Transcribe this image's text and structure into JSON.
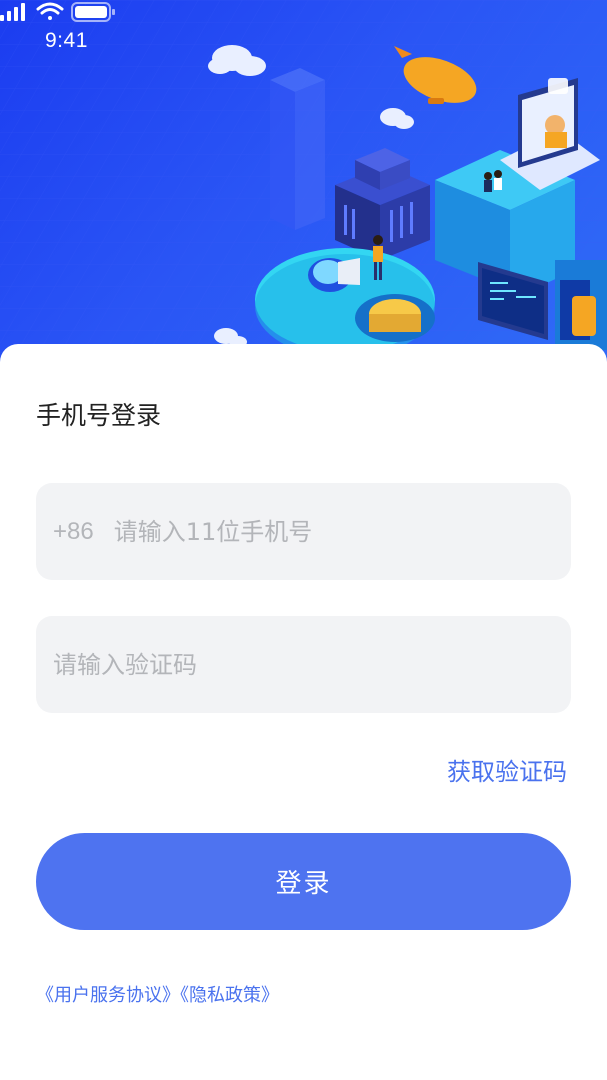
{
  "status_bar": {
    "time": "9:41",
    "icons": [
      "signal-icon",
      "wifi-icon",
      "battery-icon"
    ]
  },
  "hero": {
    "illustration": "isometric-city-illustration",
    "background_color": "#1f44f2"
  },
  "login": {
    "title": "手机号登录",
    "phone": {
      "prefix": "+86",
      "placeholder": "请输入11位手机号",
      "value": ""
    },
    "code": {
      "placeholder": "请输入验证码",
      "value": ""
    },
    "get_code_label": "获取验证码",
    "submit_label": "登录"
  },
  "agreements": {
    "user_agreement": "《用户服务协议》",
    "privacy_policy": "《隐私政策》"
  },
  "colors": {
    "accent": "#4e73f0",
    "link": "#4a72ee",
    "input_bg": "#f2f3f5",
    "placeholder": "#b3b5b9"
  }
}
